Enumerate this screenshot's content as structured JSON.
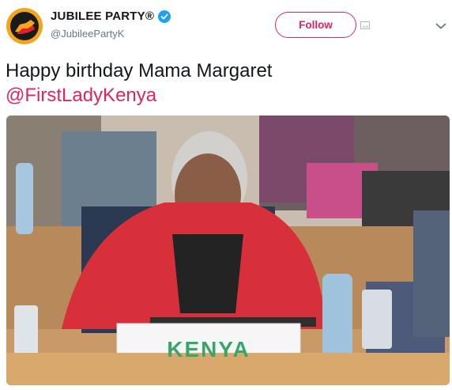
{
  "author": {
    "display_name": "JUBILEE PARTY®",
    "handle": "@JubileePartyK",
    "verified": true,
    "avatar_icon": "jubilee-handshake-logo-icon"
  },
  "actions": {
    "follow_label": "Follow",
    "menu_icon": "chevron-down-icon",
    "media_icon": "image-icon"
  },
  "tweet": {
    "text": "Happy birthday Mama Margaret",
    "mention": "@FirstLadyKenya"
  },
  "photo": {
    "table_sign": "KENYA"
  },
  "colors": {
    "accent": "#e0245e",
    "verified_blue": "#1da1f2",
    "avatar_yellow": "#f4a51c",
    "jacket_red": "#d8303a",
    "sign_green": "#3aa56a"
  }
}
